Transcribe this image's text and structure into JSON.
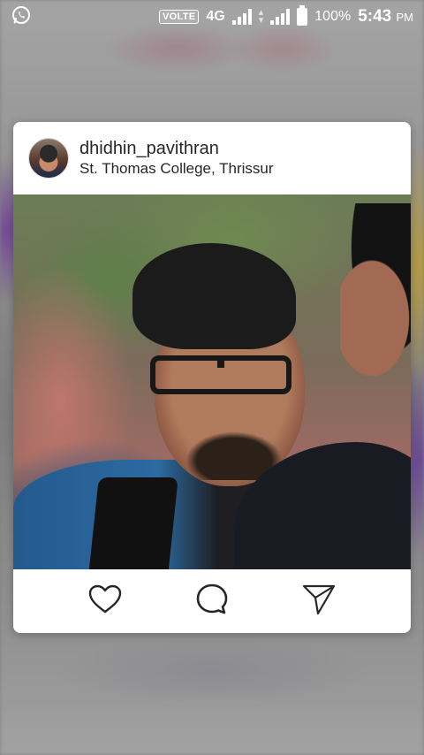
{
  "status_bar": {
    "app_notification_icon": "whatsapp-icon",
    "volte": "VOLTE",
    "network": "4G",
    "battery_percent": "100%",
    "time": "5:43",
    "am_pm": "PM"
  },
  "post_preview": {
    "username": "dhidhin_pavithran",
    "location": "St. Thomas College, Thrissur",
    "avatar_icon": "profile-avatar",
    "photo_icon": "post-photo",
    "actions": [
      {
        "name": "like",
        "icon": "heart-outline-icon"
      },
      {
        "name": "comment",
        "icon": "speech-bubble-icon"
      },
      {
        "name": "share",
        "icon": "paper-plane-icon"
      }
    ]
  },
  "colors": {
    "card_background": "#ffffff",
    "text": "#262626",
    "icon_stroke": "#262626",
    "status_text": "#ffffff"
  }
}
